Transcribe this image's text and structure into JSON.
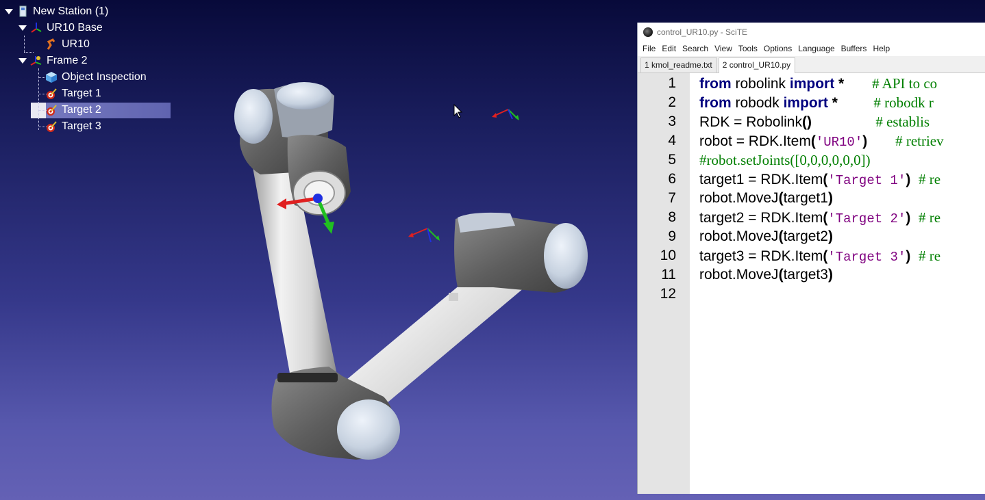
{
  "station_tree": {
    "items": [
      {
        "label": "New Station (1)",
        "icon": "station-icon",
        "expanded": true
      },
      {
        "label": "UR10 Base",
        "icon": "reference-frame-icon",
        "expanded": true
      },
      {
        "label": "UR10",
        "icon": "robot-icon"
      },
      {
        "label": "Frame 2",
        "icon": "frame-icon",
        "expanded": true
      },
      {
        "label": "Object Inspection",
        "icon": "object-cube-icon"
      },
      {
        "label": "Target 1",
        "icon": "target-icon"
      },
      {
        "label": "Target 2",
        "icon": "target-icon",
        "selected": true
      },
      {
        "label": "Target 3",
        "icon": "target-icon"
      }
    ]
  },
  "editor": {
    "title": "control_UR10.py - SciTE",
    "menu": [
      "File",
      "Edit",
      "Search",
      "View",
      "Tools",
      "Options",
      "Language",
      "Buffers",
      "Help"
    ],
    "tabs": [
      {
        "label": "1 kmol_readme.txt",
        "active": false
      },
      {
        "label": "2 control_UR10.py",
        "active": true
      }
    ],
    "line_numbers": [
      "1",
      "2",
      "3",
      "4",
      "5",
      "6",
      "7",
      "8",
      "9",
      "10",
      "11",
      "12"
    ],
    "lines": [
      {
        "kw1": "from",
        "t1": " robolink ",
        "kw2": "import",
        "t2": " *",
        "gap": "       ",
        "cmt": "# API to co"
      },
      {
        "kw1": "from",
        "t1": " robodk ",
        "kw2": "import",
        "t2": " *",
        "gap": "         ",
        "cmt": "# robodk r"
      },
      {
        "t1": "RDK = Robolink",
        "p1": "()",
        "gap": "                ",
        "cmt": "# establis"
      },
      {
        "t1": "robot = RDK.Item",
        "p1": "(",
        "s1": "'UR10'",
        "p2": ")",
        "gap": "       ",
        "cmt": "# retriev"
      },
      {
        "cmt": "#robot.setJoints([0,0,0,0,0,0])"
      },
      {
        "t1": "target1 = RDK.Item",
        "p1": "(",
        "s1": "'Target 1'",
        "p2": ")",
        "gap": "  ",
        "cmt": "# re"
      },
      {
        "t1": "robot.MoveJ",
        "p1": "(",
        "t2": "target1",
        "p2": ")"
      },
      {
        "t1": "target2 = RDK.Item",
        "p1": "(",
        "s1": "'Target 2'",
        "p2": ")",
        "gap": "  ",
        "cmt": "# re"
      },
      {
        "t1": "robot.MoveJ",
        "p1": "(",
        "t2": "target2",
        "p2": ")"
      },
      {
        "t1": "target3 = RDK.Item",
        "p1": "(",
        "s1": "'Target 3'",
        "p2": ")",
        "gap": "  ",
        "cmt": "# re"
      },
      {
        "t1": "robot.MoveJ",
        "p1": "(",
        "t2": "target3",
        "p2": ")"
      },
      {}
    ]
  },
  "colors": {
    "keyword": "#00007f",
    "string": "#7f007f",
    "comment": "#007f00",
    "axis_x": "#e02020",
    "axis_y": "#20c020",
    "axis_z": "#2030e0"
  }
}
